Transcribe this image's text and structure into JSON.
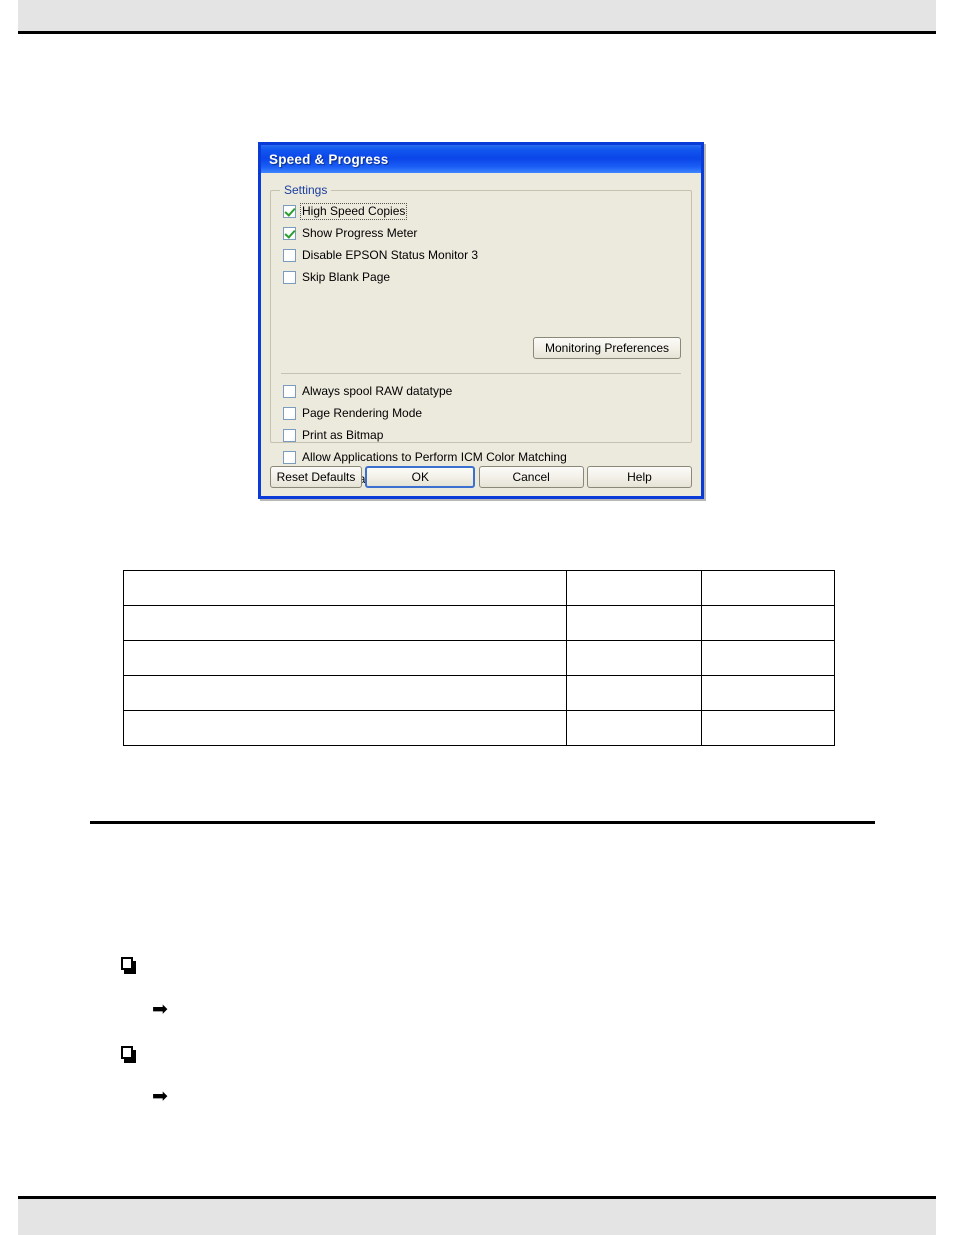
{
  "page": {
    "header_text": "",
    "footer_text": "",
    "background_color": "#ffffff"
  },
  "dialog": {
    "title": "Speed & Progress",
    "title_bar_color": "#0b45e8",
    "background_color": "#ece9dd",
    "border_color": "#0a3ad8",
    "group": {
      "legend": "Settings",
      "legend_color": "#1a3f9e",
      "top_checkboxes": [
        {
          "label": "High Speed Copies",
          "checked": true,
          "focused": true
        },
        {
          "label": "Show Progress Meter",
          "checked": true,
          "focused": false
        },
        {
          "label": "Disable EPSON Status Monitor 3",
          "checked": false,
          "focused": false
        },
        {
          "label": "Skip Blank Page",
          "checked": false,
          "focused": false
        }
      ],
      "monitoring_button": "Monitoring Preferences",
      "bottom_checkboxes": [
        {
          "label": "Always spool RAW datatype",
          "checked": false,
          "focused": false
        },
        {
          "label": "Page Rendering Mode",
          "checked": false,
          "focused": false
        },
        {
          "label": "Print as Bitmap",
          "checked": false,
          "focused": false
        },
        {
          "label": "Allow Applications to Perform ICM Color Matching",
          "checked": false,
          "focused": false
        },
        {
          "label": "Change Standard Resolution",
          "checked": false,
          "focused": false
        }
      ]
    },
    "buttons": {
      "reset": "Reset Defaults",
      "ok": "OK",
      "cancel": "Cancel",
      "help": "Help",
      "default_button": "OK"
    }
  },
  "table": {
    "columns": [
      "",
      "",
      ""
    ],
    "rows": [
      [
        "",
        "",
        ""
      ],
      [
        "",
        "",
        ""
      ],
      [
        "",
        "",
        ""
      ],
      [
        "",
        "",
        ""
      ],
      [
        "",
        "",
        ""
      ]
    ]
  },
  "body_items": [
    {
      "bullet": "box-bullet-icon",
      "text": ""
    },
    {
      "bullet": "arrow-bullet-icon",
      "text": ""
    },
    {
      "bullet": "box-bullet-icon",
      "text": ""
    },
    {
      "bullet": "arrow-bullet-icon",
      "text": ""
    }
  ],
  "icons": {
    "arrow_glyph": "➡",
    "check_glyph": "✓"
  }
}
